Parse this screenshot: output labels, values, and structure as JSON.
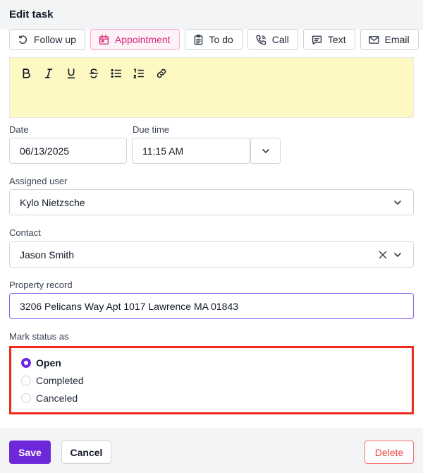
{
  "header": {
    "title": "Edit task"
  },
  "task_types": [
    {
      "label": "Follow up",
      "icon": "follow-up-icon"
    },
    {
      "label": "Appointment",
      "icon": "calendar-icon",
      "selected": true
    },
    {
      "label": "To do",
      "icon": "clipboard-icon"
    },
    {
      "label": "Call",
      "icon": "phone-icon"
    },
    {
      "label": "Text",
      "icon": "message-icon"
    },
    {
      "label": "Email",
      "icon": "mail-icon"
    }
  ],
  "editor": {
    "tools": [
      "bold-icon",
      "italic-icon",
      "underline-icon",
      "strikethrough-icon",
      "bulleted-list-icon",
      "numbered-list-icon",
      "link-icon"
    ],
    "content": ""
  },
  "date": {
    "label": "Date",
    "value": "06/13/2025"
  },
  "due_time": {
    "label": "Due time",
    "value": "11:15 AM"
  },
  "assigned_user": {
    "label": "Assigned user",
    "value": "Kylo Nietzsche"
  },
  "contact": {
    "label": "Contact",
    "value": "Jason Smith"
  },
  "property_record": {
    "label": "Property record",
    "value": "3206 Pelicans Way Apt 1017 Lawrence MA 01843"
  },
  "status": {
    "label": "Mark status as",
    "options": [
      {
        "label": "Open",
        "checked": true
      },
      {
        "label": "Completed",
        "checked": false
      },
      {
        "label": "Canceled",
        "checked": false
      }
    ]
  },
  "footer": {
    "save_label": "Save",
    "cancel_label": "Cancel",
    "delete_label": "Delete"
  },
  "colors": {
    "accent": "#6d28d9",
    "selected_type": "#db2777",
    "editor_bg": "#fef9c3",
    "highlight_border": "#ef2a1c",
    "delete": "#ef4444"
  }
}
